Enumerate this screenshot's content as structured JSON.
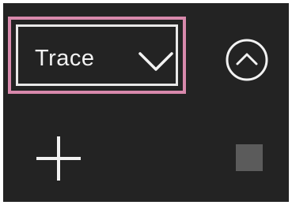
{
  "mode_selector": {
    "label": "Trace",
    "icon": "chevron-down-icon"
  },
  "buttons": {
    "collapse_icon": "chevron-up-circle-icon",
    "add_icon": "plus-icon",
    "stop_icon": "stop-square-icon"
  },
  "colors": {
    "background": "#232323",
    "foreground": "#f2f2f2",
    "focus_highlight": "#d889ac",
    "stop_square": "#5b5b5b"
  }
}
